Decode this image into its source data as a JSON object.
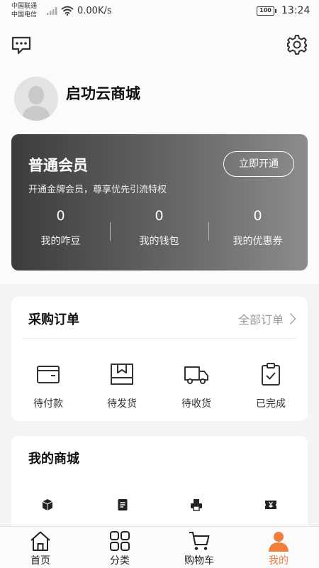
{
  "status_bar": {
    "carrier_1": "中国联通",
    "carrier_2": "中国电信",
    "net_speed": "0.00K/s",
    "battery": "100",
    "time": "13:24"
  },
  "header": {
    "message_icon": "chat-bubble-icon",
    "settings_icon": "gear-icon"
  },
  "profile": {
    "username": "启功云商城",
    "avatar_icon": "default-avatar-icon"
  },
  "membership": {
    "title": "普通会员",
    "subtitle": "开通金牌会员，尊享优先引流特权",
    "open_button": "立即开通",
    "stats": [
      {
        "value": "0",
        "label": "我的咋豆"
      },
      {
        "value": "0",
        "label": "我的钱包"
      },
      {
        "value": "0",
        "label": "我的优惠券"
      }
    ]
  },
  "orders": {
    "title": "采购订单",
    "all_link": "全部订单",
    "items": [
      {
        "label": "待付款",
        "icon": "wallet-icon"
      },
      {
        "label": "待发货",
        "icon": "package-icon"
      },
      {
        "label": "待收货",
        "icon": "truck-icon"
      },
      {
        "label": "已完成",
        "icon": "clipboard-check-icon"
      }
    ]
  },
  "mall": {
    "title": "我的商城",
    "icons": [
      "box-icon",
      "document-icon",
      "printer-icon",
      "yen-ticket-icon"
    ]
  },
  "tabs": [
    {
      "label": "首页",
      "icon": "home-icon"
    },
    {
      "label": "分类",
      "icon": "grid-icon"
    },
    {
      "label": "购物车",
      "icon": "cart-icon"
    },
    {
      "label": "我的",
      "icon": "person-icon",
      "active": true
    }
  ],
  "colors": {
    "accent": "#f07e3c",
    "card_dark": "#3d3b3c",
    "card_light": "#8d8b8b"
  }
}
